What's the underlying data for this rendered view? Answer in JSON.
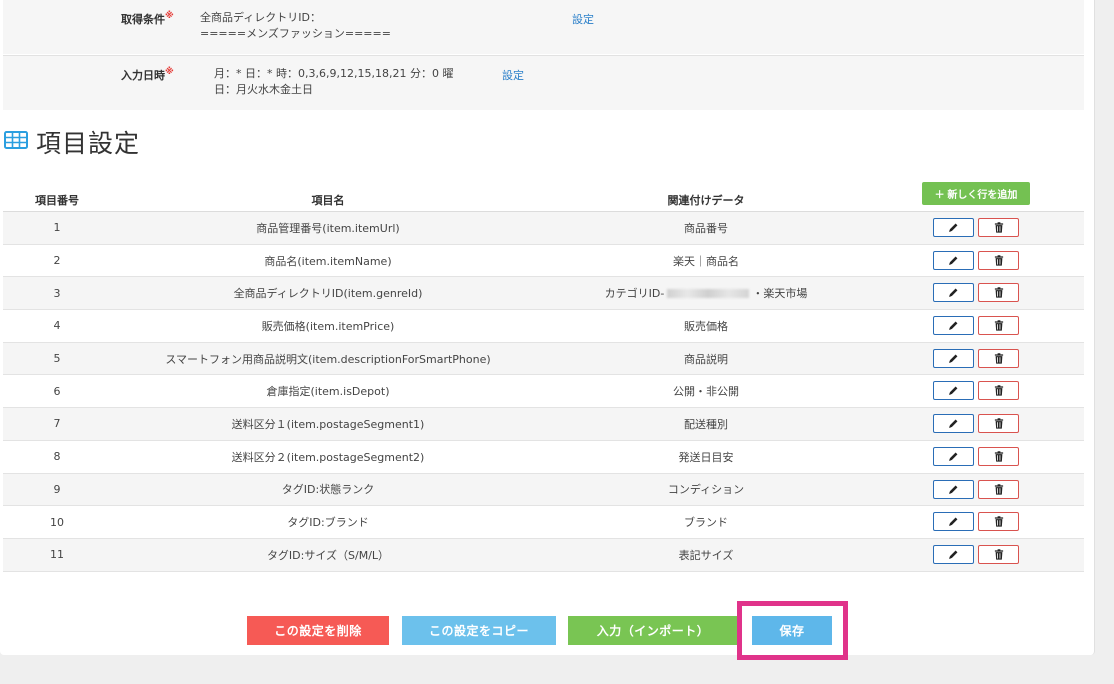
{
  "conditions": [
    {
      "label": "取得条件",
      "required_mark": "※",
      "values": [
        "全商品ディレクトリID：",
        "=====メンズファッション====="
      ],
      "link": "設定"
    },
    {
      "label": "入力日時",
      "required_mark": "※",
      "values": [
        "月：* 日：* 時：0,3,6,9,12,15,18,21 分：0 曜",
        "日：月火水木金土日"
      ],
      "link": "設定"
    }
  ],
  "section": {
    "title": "項目設定",
    "icon": "table-icon"
  },
  "table": {
    "headers": {
      "no": "項目番号",
      "name": "項目名",
      "data": "関連付けデータ"
    },
    "add_label": "＋ 新しく行を追加",
    "rows": [
      {
        "no": "1",
        "name": "商品管理番号(item.itemUrl)",
        "data": "商品番号"
      },
      {
        "no": "2",
        "name": "商品名(item.itemName)",
        "data": "楽天｜商品名"
      },
      {
        "no": "3",
        "name": "全商品ディレクトリID(item.genreId)",
        "data_prefix": "カテゴリID-",
        "data_suffix": "・楽天市場"
      },
      {
        "no": "4",
        "name": "販売価格(item.itemPrice)",
        "data": "販売価格"
      },
      {
        "no": "5",
        "name": "スマートフォン用商品説明文(item.descriptionForSmartPhone)",
        "data": "商品説明"
      },
      {
        "no": "6",
        "name": "倉庫指定(item.isDepot)",
        "data": "公開・非公開"
      },
      {
        "no": "7",
        "name": "送料区分１(item.postageSegment1)",
        "data": "配送種別"
      },
      {
        "no": "8",
        "name": "送料区分２(item.postageSegment2)",
        "data": "発送日目安"
      },
      {
        "no": "9",
        "name": "タグID:状態ランク",
        "data": "コンディション"
      },
      {
        "no": "10",
        "name": "タグID:ブランド",
        "data": "ブランド"
      },
      {
        "no": "11",
        "name": "タグID:サイズ（S/M/L）",
        "data": "表記サイズ"
      }
    ]
  },
  "footer": {
    "delete_label": "この設定を削除",
    "copy_label": "この設定をコピー",
    "import_label": "入力（インポート）",
    "save_label": "保存"
  },
  "colors": {
    "delete": "#f65a55",
    "copy": "#6cc1ec",
    "import": "#79c553",
    "save": "#5eb7ea",
    "highlight": "#e0338a",
    "link": "#2a7fc9"
  }
}
